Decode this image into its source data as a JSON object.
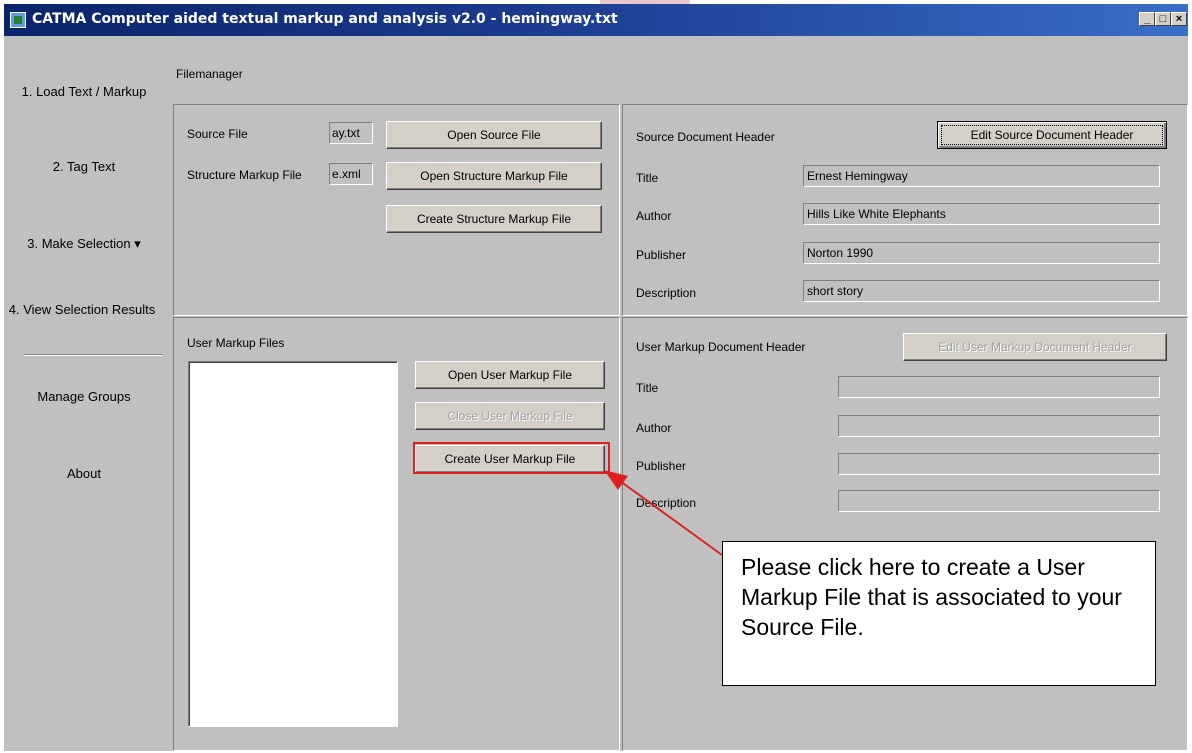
{
  "window": {
    "title": "CATMA Computer aided textual markup and analysis v2.0  - hemingway.txt",
    "controls": {
      "minimize": "_",
      "maximize": "□",
      "close": "×"
    }
  },
  "sidebar": {
    "items": [
      {
        "label": "1. Load Text / Markup"
      },
      {
        "label": "2. Tag Text"
      },
      {
        "label": "3. Make Selection ▾"
      },
      {
        "label": "4. View Selection Results"
      },
      {
        "label": "Manage Groups"
      },
      {
        "label": "About"
      }
    ]
  },
  "main": {
    "section_title": "Filemanager",
    "source": {
      "source_file_label": "Source File",
      "source_file_value": "ay.txt",
      "structure_label": "Structure Markup File",
      "structure_value": "e.xml",
      "open_source_button": "Open Source File",
      "open_structure_button": "Open Structure Markup File",
      "create_structure_button": "Create Structure Markup File"
    },
    "source_header": {
      "heading": "Source Document Header",
      "edit_button": "Edit Source Document Header",
      "fields": [
        {
          "label": "Title",
          "value": "Ernest Hemingway"
        },
        {
          "label": "Author",
          "value": "Hills Like White Elephants"
        },
        {
          "label": "Publisher",
          "value": "Norton 1990"
        },
        {
          "label": "Description",
          "value": "short story"
        }
      ]
    },
    "user_markup": {
      "heading": "User Markup Files",
      "open_button": "Open User Markup File",
      "close_button": "Close User Markup File",
      "create_button": "Create User Markup File"
    },
    "user_header": {
      "heading": "User Markup Document Header",
      "edit_button": "Edit User Markup Document Header",
      "fields": [
        {
          "label": "Title",
          "value": ""
        },
        {
          "label": "Author",
          "value": ""
        },
        {
          "label": "Publisher",
          "value": ""
        },
        {
          "label": "Description",
          "value": ""
        }
      ]
    }
  },
  "annotation": {
    "callout_text": "Please click here to create a User Markup File that is associated to your Source File.",
    "highlight_color": "#e02020",
    "arrow_color": "#e02020"
  },
  "colors": {
    "titlebar_start": "#0a246a",
    "titlebar_end": "#3a6ec7",
    "window_bg": "#c0c0c0"
  }
}
